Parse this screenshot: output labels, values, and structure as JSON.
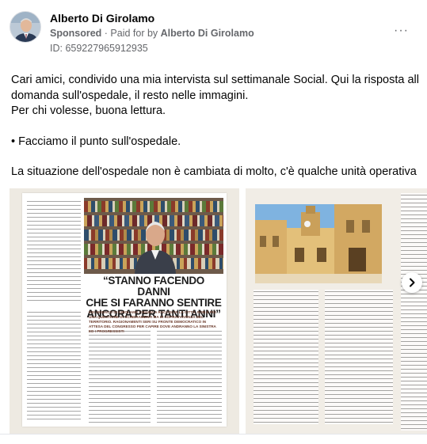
{
  "post": {
    "author": "Alberto Di Girolamo",
    "sponsored_label": "Sponsored",
    "paid_prefix": "· Paid for by",
    "paid_by": "Alberto Di Girolamo",
    "ad_id": "ID: 659227965912935",
    "more_icon": "more-horizontal-icon",
    "more_label": "···"
  },
  "text": {
    "line1": "Cari amici, condivido una mia intervista sul settimanale Social. Qui la risposta alla",
    "line2": "domanda sull'ospedale, il resto nelle immagini.",
    "line3": "Per chi volesse, buona lettura.",
    "line4": "• Facciamo il punto sull'ospedale.",
    "line5": "La situazione dell'ospedale non è cambiata di molto, c'è qualche unità operativa i..."
  },
  "carousel": {
    "headline_line1": "“STANNO FACENDO DANNI",
    "headline_line2": "CHE SI FARANNO SENTIRE",
    "headline_line3": "ANCORA PER TANTI ANNI”",
    "caption": "DEI SINDACO DI GIROLAMO CHIAMA A RACCOLTA LA CITTÀ. NON È PIÙ UNA QUESTIONE DI SCHIERAMENTI MA DI SOPRAVVIVENZA DEL TERRITORIO. RAGIONAMENTI SERI SU FRONTE DEMOCRATICO IN ATTESA DEL CONGRESSO PER CAPIRE DOVE ANDRANNO LA SINISTRA ED I PROGRESSISTI",
    "next_icon": "chevron-right-icon"
  }
}
